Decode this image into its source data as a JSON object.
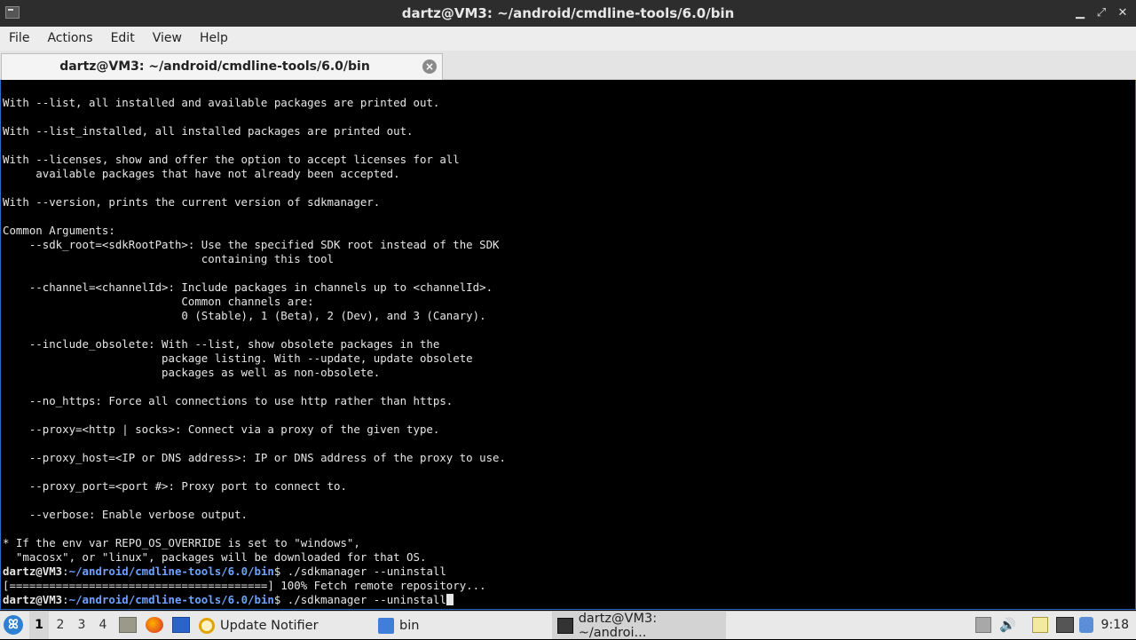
{
  "window": {
    "title": "dartz@VM3: ~/android/cmdline-tools/6.0/bin"
  },
  "menu": [
    "File",
    "Actions",
    "Edit",
    "View",
    "Help"
  ],
  "tab": {
    "label": "dartz@VM3: ~/android/cmdline-tools/6.0/bin"
  },
  "terminal": {
    "lines": [
      "With --list, all installed and available packages are printed out.",
      "",
      "With --list_installed, all installed packages are printed out.",
      "",
      "With --licenses, show and offer the option to accept licenses for all",
      "     available packages that have not already been accepted.",
      "",
      "With --version, prints the current version of sdkmanager.",
      "",
      "Common Arguments:",
      "    --sdk_root=<sdkRootPath>: Use the specified SDK root instead of the SDK",
      "                              containing this tool",
      "",
      "    --channel=<channelId>: Include packages in channels up to <channelId>.",
      "                           Common channels are:",
      "                           0 (Stable), 1 (Beta), 2 (Dev), and 3 (Canary).",
      "",
      "    --include_obsolete: With --list, show obsolete packages in the",
      "                        package listing. With --update, update obsolete",
      "                        packages as well as non-obsolete.",
      "",
      "    --no_https: Force all connections to use http rather than https.",
      "",
      "    --proxy=<http | socks>: Connect via a proxy of the given type.",
      "",
      "    --proxy_host=<IP or DNS address>: IP or DNS address of the proxy to use.",
      "",
      "    --proxy_port=<port #>: Proxy port to connect to.",
      "",
      "    --verbose: Enable verbose output.",
      "",
      "* If the env var REPO_OS_OVERRIDE is set to \"windows\",",
      "  \"macosx\", or \"linux\", packages will be downloaded for that OS."
    ],
    "prompt_user": "dartz@VM3",
    "prompt_sep": ":",
    "prompt_path": "~/android/cmdline-tools/6.0/bin",
    "prompt_end": "$ ",
    "command1": "./sdkmanager --uninstall",
    "progress_line": "[=======================================] 100% Fetch remote repository...",
    "command2": "./sdkmanager --uninstall"
  },
  "taskbar": {
    "workspaces": [
      "1",
      "2",
      "3",
      "4"
    ],
    "active_workspace": "1",
    "buttons": {
      "update_notifier": "Update Notifier",
      "bin": "bin",
      "terminal": "dartz@VM3: ~/androi..."
    },
    "clock": "9:18"
  },
  "colors": {
    "prompt_path": "#6da2ff",
    "terminal_bg": "#000000",
    "titlebar_bg": "#2d2d2d"
  }
}
